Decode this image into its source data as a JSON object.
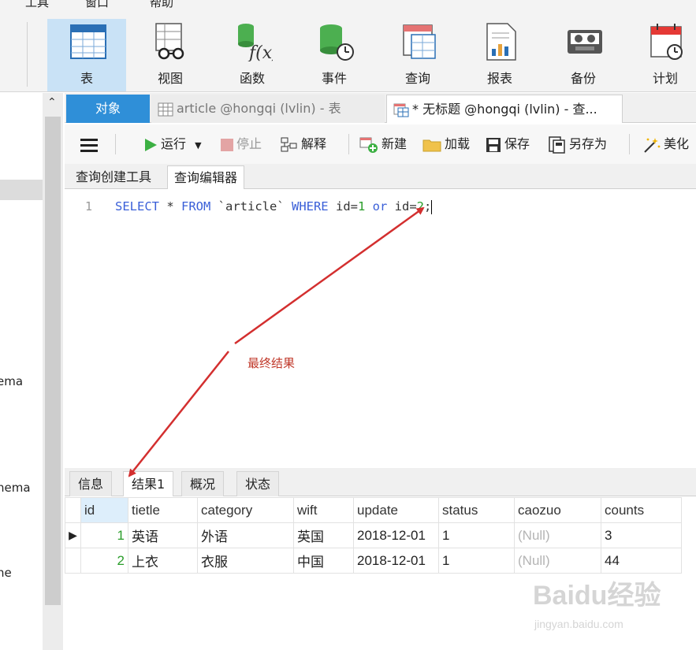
{
  "menu": {
    "items": [
      "工具",
      "窗口",
      "帮助"
    ]
  },
  "ribbon": {
    "buttons": [
      {
        "label": "表",
        "icon": "table-icon",
        "active": true
      },
      {
        "label": "视图",
        "icon": "view-icon"
      },
      {
        "label": "函数",
        "icon": "function-icon"
      },
      {
        "label": "事件",
        "icon": "event-icon"
      },
      {
        "label": "查询",
        "icon": "query-icon"
      },
      {
        "label": "报表",
        "icon": "report-icon"
      },
      {
        "label": "备份",
        "icon": "backup-icon"
      },
      {
        "label": "计划",
        "icon": "schedule-icon"
      }
    ]
  },
  "left_pane": {
    "items": [
      "ema",
      "hema",
      "ne"
    ]
  },
  "tabs": {
    "object": "对象",
    "tab1": "article @hongqi (lvlin) - 表",
    "tab2": "* 无标题 @hongqi (lvlin) - 查..."
  },
  "toolbar": {
    "menu_icon": "hamburger-icon",
    "run": "运行",
    "stop": "停止",
    "explain": "解释",
    "new": "新建",
    "load": "加载",
    "save": "保存",
    "save_as": "另存为",
    "beautify": "美化"
  },
  "subtabs": {
    "builder": "查询创建工具",
    "editor": "查询编辑器"
  },
  "editor": {
    "line_number": "1",
    "tokens": [
      {
        "text": "SELECT",
        "type": "kw"
      },
      {
        "text": " * ",
        "type": "plain"
      },
      {
        "text": "FROM",
        "type": "kw"
      },
      {
        "text": " `article` ",
        "type": "plain"
      },
      {
        "text": "WHERE",
        "type": "kw"
      },
      {
        "text": " id=",
        "type": "plain"
      },
      {
        "text": "1",
        "type": "num"
      },
      {
        "text": " ",
        "type": "plain"
      },
      {
        "text": "or",
        "type": "kw"
      },
      {
        "text": " id=",
        "type": "plain"
      },
      {
        "text": "2",
        "type": "num"
      },
      {
        "text": ";",
        "type": "plain"
      }
    ]
  },
  "annotation": {
    "text": "最终结果",
    "color": "#c0392b"
  },
  "results": {
    "tabs": [
      "信息",
      "结果1",
      "概况",
      "状态"
    ],
    "active_tab": 1,
    "columns": [
      "id",
      "tietle",
      "category",
      "wift",
      "update",
      "status",
      "caozuo",
      "counts"
    ],
    "rows": [
      [
        "1",
        "英语",
        "外语",
        "英国",
        "2018-12-01",
        "1",
        "(Null)",
        "3"
      ],
      [
        "2",
        "上衣",
        "衣服",
        "中国",
        "2018-12-01",
        "1",
        "(Null)",
        "44"
      ]
    ]
  },
  "watermark": {
    "logo": "Baidu经验",
    "url": "jingyan.baidu.com"
  },
  "colors": {
    "accent": "#2f8fd8",
    "selected_ribbon": "#c9e2f6",
    "keyword": "#3a5fd8",
    "number": "#2a9d2a",
    "arrow": "#d32f2f"
  }
}
